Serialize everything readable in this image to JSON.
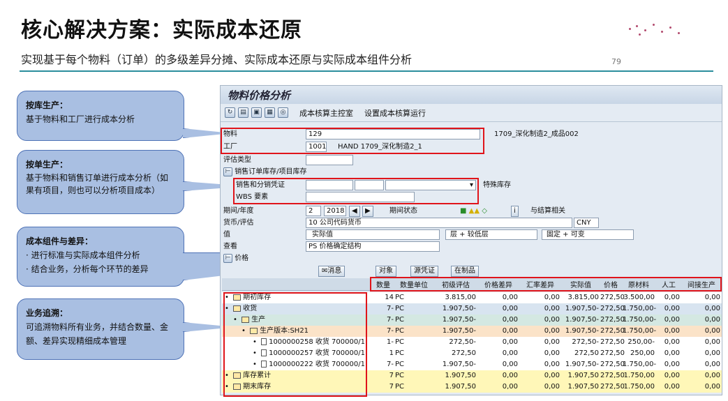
{
  "slide": {
    "title": "核心解决方案：实际成本还原",
    "subtitle": "实现基于每个物料（订单）的多级差异分摊、实际成本还原与实际成本组件分析",
    "page_number": "79",
    "accent_color": "#2a8d9c"
  },
  "callouts": [
    {
      "heading": "按库生产：",
      "body": "基于物料和工厂进行成本分析"
    },
    {
      "heading": "按单生产：",
      "body": "基于物料和销售订单进行成本分析（如果有项目，则也可以分析项目成本）"
    },
    {
      "heading": "成本组件与差异：",
      "line1": "· 进行标准与实际成本组件分析",
      "line2": "· 结合业务，分析每个环节的差异"
    },
    {
      "heading": "业务追溯：",
      "body": "可追溯物料所有业务，并结合数量、金额、差异实现精细成本管理"
    }
  ],
  "sap": {
    "window_title": "物料价格分析",
    "toolbar": {
      "cockpit": "成本核算主控室",
      "settings": "设置成本核算运行"
    },
    "fields": {
      "material_label": "物料",
      "material_value": "129",
      "material_desc": "1709_深化制造2_成品002",
      "plant_label": "工厂",
      "plant_value": "1001",
      "plant_desc": "HAND 1709_深化制造2_1",
      "valtype_label": "评估类型",
      "sales_stock_label": "销售订单库存/项目库存",
      "sales_doc_label": "销售和分销凭证",
      "special_stock_label": "特殊库存",
      "wbs_label": "WBS 要素",
      "period_label": "期间/年度",
      "period_value": "2",
      "year_value": "2018",
      "period_status_label": "期间状态",
      "settlement_label": "与结算相关",
      "currency_label": "货币/评估",
      "currency_value": "10 公司代码货币",
      "currency_code": "CNY",
      "value_label": "值",
      "value_value": "实际值",
      "layer_value": "层 + 较低层",
      "fixed_value": "固定 + 可变",
      "view_label": "查看",
      "view_value": "PS 价格确定结构",
      "price_label": "价格"
    },
    "grid_buttons": {
      "message": "消息",
      "object": "对象",
      "source_doc": "源凭证",
      "wip": "在制品"
    },
    "columns": [
      "数量",
      "数量单位",
      "初级评估",
      "价格差异",
      "汇率差异",
      "实际值",
      "价格",
      "原材料",
      "人工",
      "间接生产"
    ],
    "rows": [
      {
        "label": "期初库存",
        "qty": "14",
        "unit": "PC",
        "primary": "3.815,00",
        "pricevar": "0,00",
        "fxvar": "0,00",
        "actual": "3.815,00",
        "price": "272,50",
        "raw": "3.500,00",
        "labor": "0,00",
        "overhead": "0,00"
      },
      {
        "label": "收货",
        "qty": "7-",
        "unit": "PC",
        "primary": "1.907,50-",
        "pricevar": "0,00",
        "fxvar": "0,00",
        "actual": "1.907,50-",
        "price": "272,50",
        "raw": "1.750,00-",
        "labor": "0,00",
        "overhead": "0,00"
      },
      {
        "label": "生产",
        "qty": "7-",
        "unit": "PC",
        "primary": "1.907,50-",
        "pricevar": "0,00",
        "fxvar": "0,00",
        "actual": "1.907,50-",
        "price": "272,50",
        "raw": "1.750,00-",
        "labor": "0,00",
        "overhead": "0,00"
      },
      {
        "label": "生产版本:SH21",
        "qty": "7-",
        "unit": "PC",
        "primary": "1.907,50-",
        "pricevar": "0,00",
        "fxvar": "0,00",
        "actual": "1.907,50-",
        "price": "272,50",
        "raw": "1.750,00-",
        "labor": "0,00",
        "overhead": "0,00"
      },
      {
        "label": "1000000258 收货 700000/1",
        "qty": "1-",
        "unit": "PC",
        "primary": "272,50-",
        "pricevar": "0,00",
        "fxvar": "0,00",
        "actual": "272,50-",
        "price": "272,50",
        "raw": "250,00-",
        "labor": "0,00",
        "overhead": "0,00"
      },
      {
        "label": "1000000257 收货 700000/1",
        "qty": "1",
        "unit": "PC",
        "primary": "272,50",
        "pricevar": "0,00",
        "fxvar": "0,00",
        "actual": "272,50",
        "price": "272,50",
        "raw": "250,00",
        "labor": "0,00",
        "overhead": "0,00"
      },
      {
        "label": "1000000222 收货 700000/1",
        "qty": "7-",
        "unit": "PC",
        "primary": "1.907,50-",
        "pricevar": "0,00",
        "fxvar": "0,00",
        "actual": "1.907,50-",
        "price": "272,50",
        "raw": "1.750,00-",
        "labor": "0,00",
        "overhead": "0,00"
      },
      {
        "label": "库存累计",
        "qty": "7",
        "unit": "PC",
        "primary": "1.907,50",
        "pricevar": "0,00",
        "fxvar": "0,00",
        "actual": "1.907,50",
        "price": "272,50",
        "raw": "1.750,00",
        "labor": "0,00",
        "overhead": "0,00"
      },
      {
        "label": "期末库存",
        "qty": "7",
        "unit": "PC",
        "primary": "1.907,50",
        "pricevar": "0,00",
        "fxvar": "0,00",
        "actual": "1.907,50",
        "price": "272,50",
        "raw": "1.750,00",
        "labor": "0,00",
        "overhead": "0,00"
      }
    ]
  }
}
